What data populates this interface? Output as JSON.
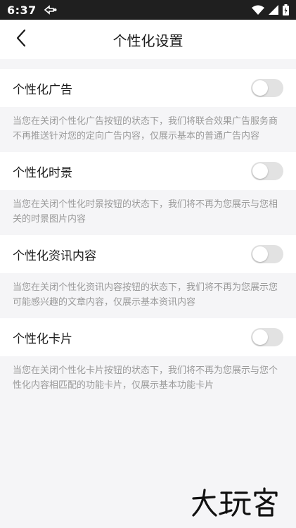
{
  "status_bar": {
    "time": "6:37"
  },
  "header": {
    "title": "个性化设置"
  },
  "settings": [
    {
      "label": "个性化广告",
      "enabled": false,
      "description": "当您在关闭个性化广告按钮的状态下，我们将联合效果广告服务商不再推送针对您的定向广告内容，仅展示基本的普通广告内容"
    },
    {
      "label": "个性化时景",
      "enabled": false,
      "description": "当您在关闭个性化时景按钮的状态下，我们将不再为您展示与您相关的时景图片内容"
    },
    {
      "label": "个性化资讯内容",
      "enabled": false,
      "description": "当您在关闭个性化资讯内容按钮的状态下，我们将不再为您展示您可能感兴趣的文章内容，仅展示基本资讯内容"
    },
    {
      "label": "个性化卡片",
      "enabled": false,
      "description": "当您在关闭个性化卡片按钮的状态下，我们将不再为您展示与您个性化内容相匹配的功能卡片，仅展示基本功能卡片"
    }
  ],
  "watermark": {
    "text": "大玩客"
  },
  "icons": {
    "back": "chevron-left-icon",
    "wifi": "wifi-icon",
    "signal": "signal-icon",
    "battery": "battery-icon",
    "notification": "app-notification-icon"
  }
}
